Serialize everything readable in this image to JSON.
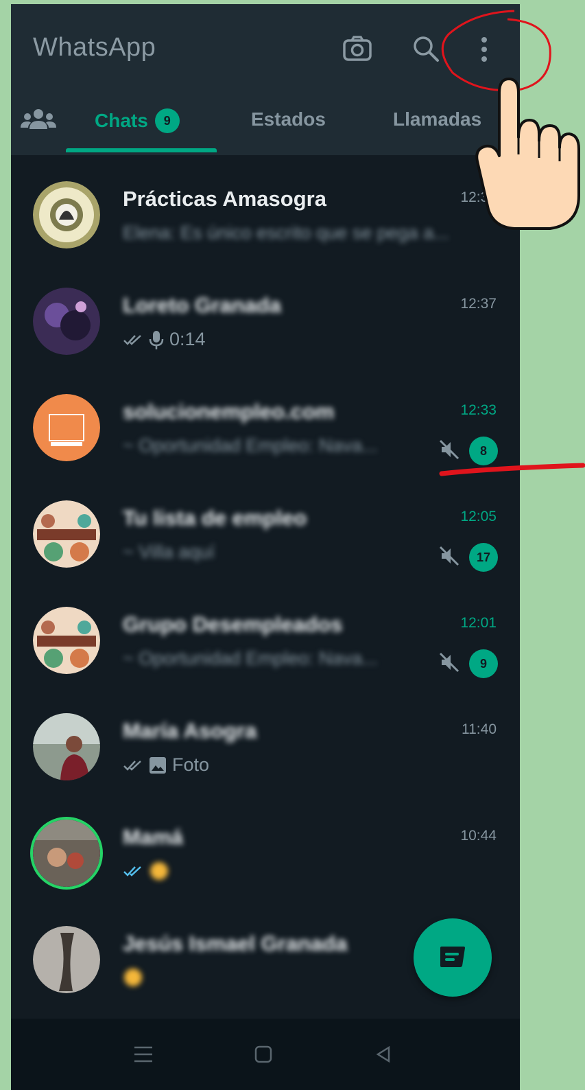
{
  "app": {
    "title": "WhatsApp"
  },
  "header": {
    "camera_icon": "camera-icon",
    "search_icon": "search-icon",
    "menu_icon": "more-vert-icon"
  },
  "tabs": {
    "community_icon": "community-icon",
    "chats_label": "Chats",
    "chats_badge": "9",
    "estados_label": "Estados",
    "llamadas_label": "Llamadas"
  },
  "chats": [
    {
      "name": "Prácticas Amasogra",
      "time": "12:37",
      "preview": "Elena: Es único escrito que se pega a...",
      "unread": "",
      "muted": false,
      "time_highlight": false
    },
    {
      "name": "Loreto Granada",
      "time": "12:37",
      "preview": "0:14",
      "preview_type": "voice",
      "unread": "",
      "muted": false,
      "time_highlight": false
    },
    {
      "name": "solucionempleo.com",
      "time": "12:33",
      "preview": "~ Oportunidad Empleo: Nava...",
      "unread": "8",
      "muted": true,
      "time_highlight": true
    },
    {
      "name": "Tu lista de empleo",
      "time": "12:05",
      "preview": "~ Villa aquí",
      "unread": "17",
      "muted": true,
      "time_highlight": true
    },
    {
      "name": "Grupo Desempleados",
      "time": "12:01",
      "preview": "~ Oportunidad Empleo: Nava...",
      "unread": "9",
      "muted": true,
      "time_highlight": true
    },
    {
      "name": "María Asogra",
      "time": "11:40",
      "preview": "Foto",
      "preview_type": "photo",
      "unread": "",
      "muted": false,
      "time_highlight": false
    },
    {
      "name": "Mamá",
      "time": "10:44",
      "preview": "",
      "preview_type": "emoji",
      "unread": "",
      "muted": false,
      "time_highlight": false
    },
    {
      "name": "Jesús Ismael Granada",
      "time": "",
      "preview": "",
      "preview_type": "emoji",
      "unread": "",
      "muted": false,
      "time_highlight": false
    }
  ],
  "fab": {
    "icon": "new-chat-icon"
  },
  "colors": {
    "accent": "#00a884",
    "background": "#121b22",
    "header": "#1f2c34",
    "frame": "#a4d3a6",
    "annotation": "#e0141c"
  }
}
